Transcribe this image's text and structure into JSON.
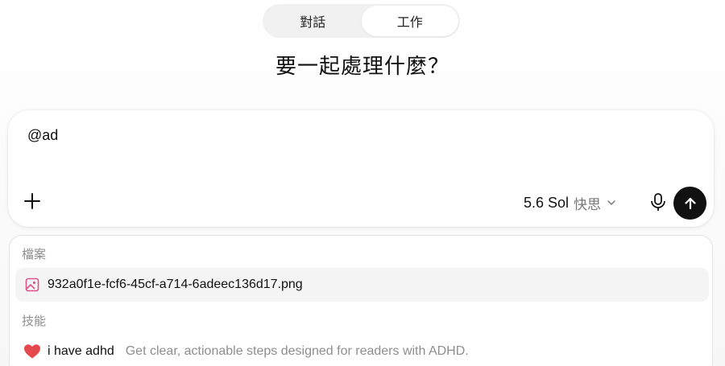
{
  "mode_toggle": {
    "tabs": [
      {
        "label": "對話"
      },
      {
        "label": "工作"
      }
    ],
    "active": "工作"
  },
  "headline": "要一起處理什麼？",
  "composer": {
    "input_value": "@ad",
    "model_name": "5.6 Sol",
    "model_mode": "快思"
  },
  "suggestions": {
    "files_label": "檔案",
    "files": [
      {
        "name": "932a0f1e-fcf6-45cf-a714-6adeec136d17.png",
        "icon": "image-file-icon"
      }
    ],
    "skills_label": "技能",
    "skills": [
      {
        "name": "i have adhd",
        "description": "Get clear, actionable steps designed for readers with ADHD.",
        "icon": "heart-icon"
      }
    ]
  },
  "colors": {
    "accent_dark": "#111111",
    "file_icon": "#d9548a",
    "heart": "#e5484d"
  }
}
